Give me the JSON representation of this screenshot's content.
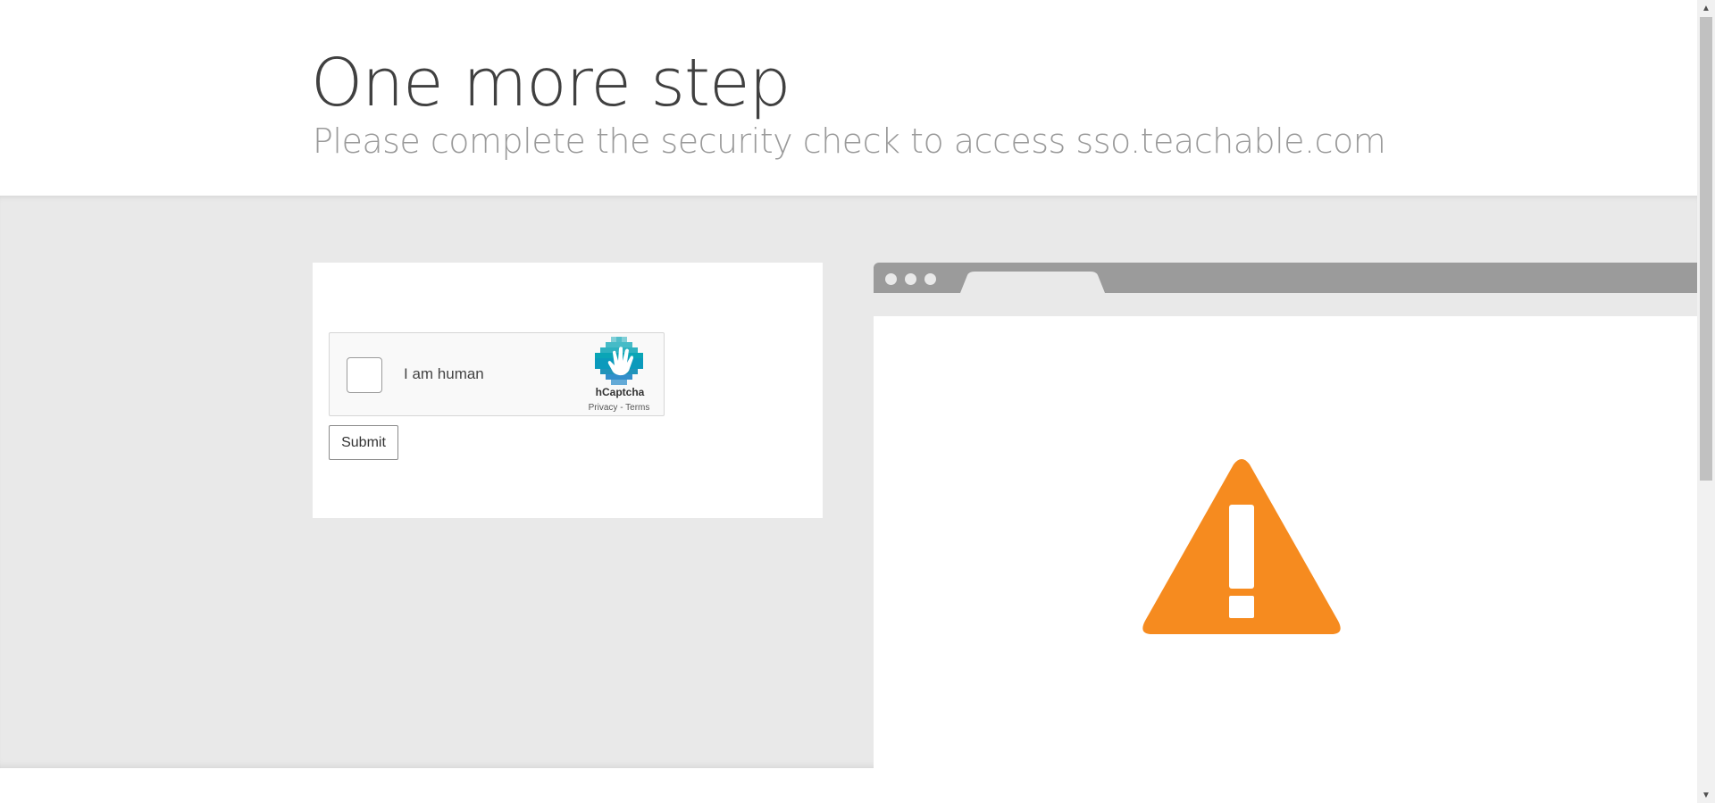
{
  "header": {
    "title": "One more step",
    "subtitle": "Please complete the security check to access sso.teachable.com"
  },
  "captcha": {
    "checkbox_label": "I am human",
    "brand": "hCaptcha",
    "privacy_link": "Privacy",
    "separator": " - ",
    "terms_link": "Terms",
    "logo_icon": "hcaptcha-hand-logo",
    "checked": false
  },
  "form": {
    "submit_label": "Submit"
  },
  "illustration": {
    "icon": "warning-triangle-icon",
    "warning_color": "#f68b1f",
    "browser_chrome_color": "#9b9b9b"
  },
  "scrollbar": {
    "up_arrow": "▲",
    "down_arrow": "▼"
  },
  "colors": {
    "band_background": "#e9e9e9",
    "title_text": "#404040",
    "subtitle_text": "#9a9a9a"
  }
}
